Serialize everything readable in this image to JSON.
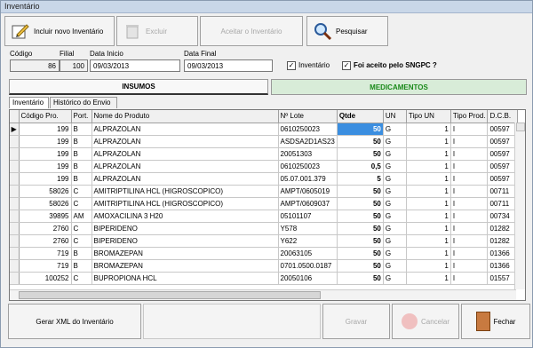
{
  "window": {
    "title": "Inventário"
  },
  "toolbar": {
    "incluir": "Incluir novo Inventário",
    "excluir": "Excluir",
    "aceitar": "Aceitar o Inventário",
    "pesquisar": "Pesquisar"
  },
  "form": {
    "codigo_label": "Código",
    "codigo_value": "86",
    "filial_label": "Filial",
    "filial_value": "100",
    "data_inicio_label": "Data Inicio",
    "data_inicio_value": "09/03/2013",
    "data_final_label": "Data Final",
    "data_final_value": "09/03/2013",
    "inventario_check_label": "Inventário",
    "sngpc_check_label": "Foi aceito pelo SNGPC ?"
  },
  "section_tabs": {
    "insumos": "INSUMOS",
    "medicamentos": "MEDICAMENTOS"
  },
  "tabs": {
    "inventario": "Inventário",
    "historico": "Histórico do Envio"
  },
  "grid": {
    "headers": [
      "Código Pro.",
      "Port.",
      "Nome do Produto",
      "Nº Lote",
      "Qtde",
      "UN",
      "Tipo UN",
      "Tipo Prod.",
      "D.C.B."
    ],
    "rows": [
      [
        "199",
        "B",
        "ALPRAZOLAN",
        "0610250023",
        "50",
        "G",
        "1",
        "I",
        "00597"
      ],
      [
        "199",
        "B",
        "ALPRAZOLAN",
        "ASDSA2D1AS23",
        "50",
        "G",
        "1",
        "I",
        "00597"
      ],
      [
        "199",
        "B",
        "ALPRAZOLAN",
        "20051303",
        "50",
        "G",
        "1",
        "I",
        "00597"
      ],
      [
        "199",
        "B",
        "ALPRAZOLAN",
        "0610250023",
        "0,5",
        "G",
        "1",
        "I",
        "00597"
      ],
      [
        "199",
        "B",
        "ALPRAZOLAN",
        "05.07.001.379",
        "5",
        "G",
        "1",
        "I",
        "00597"
      ],
      [
        "58026",
        "C",
        "AMITRIPTILINA HCL   (HIGROSCOPICO)",
        "AMPT/0605019",
        "50",
        "G",
        "1",
        "I",
        "00711"
      ],
      [
        "58026",
        "C",
        "AMITRIPTILINA HCL   (HIGROSCOPICO)",
        "AMPT/0609037",
        "50",
        "G",
        "1",
        "I",
        "00711"
      ],
      [
        "39895",
        "AM",
        "AMOXACILINA 3 H20",
        "05101107",
        "50",
        "G",
        "1",
        "I",
        "00734"
      ],
      [
        "2760",
        "C",
        "BIPERIDENO",
        "Y578",
        "50",
        "G",
        "1",
        "I",
        "01282"
      ],
      [
        "2760",
        "C",
        "BIPERIDENO",
        "Y622",
        "50",
        "G",
        "1",
        "I",
        "01282"
      ],
      [
        "719",
        "B",
        "BROMAZEPAN",
        "20063105",
        "50",
        "G",
        "1",
        "I",
        "01366"
      ],
      [
        "719",
        "B",
        "BROMAZEPAN",
        "0701.0500.0187",
        "50",
        "G",
        "1",
        "I",
        "01366"
      ],
      [
        "100252",
        "C",
        "BUPROPIONA HCL",
        "20050106",
        "50",
        "G",
        "1",
        "I",
        "01557"
      ]
    ]
  },
  "bottom": {
    "gerar": "Gerar XML do Inventário",
    "gravar": "Gravar",
    "cancelar": "Cancelar",
    "fechar": "Fechar"
  }
}
